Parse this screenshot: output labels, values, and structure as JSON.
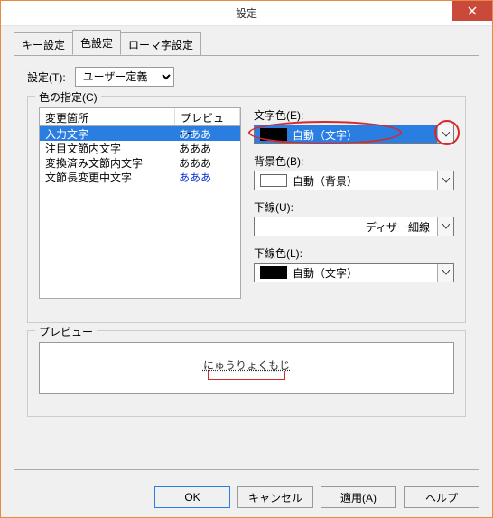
{
  "window": {
    "title": "設定"
  },
  "tabs": [
    {
      "label": "キー設定",
      "active": false
    },
    {
      "label": "色設定",
      "active": true
    },
    {
      "label": "ローマ字設定",
      "active": false
    }
  ],
  "setting": {
    "label": "設定(T):",
    "value": "ユーザー定義"
  },
  "colorgroup": {
    "legend": "色の指定(C)",
    "list": {
      "headers": {
        "col1": "変更箇所",
        "col2": "プレビュー"
      },
      "rows": [
        {
          "label": "入力文字",
          "preview": "あああ",
          "selected": true,
          "previewBlue": false
        },
        {
          "label": "注目文節内文字",
          "preview": "あああ",
          "selected": false,
          "previewBlue": false
        },
        {
          "label": "変換済み文節内文字",
          "preview": "あああ",
          "selected": false,
          "previewBlue": false
        },
        {
          "label": "文節長変更中文字",
          "preview": "あああ",
          "selected": false,
          "previewBlue": true
        }
      ]
    },
    "foreground": {
      "label": "文字色(E):",
      "text": "自動（文字）",
      "swatch": "#000000",
      "selected": true
    },
    "background": {
      "label": "背景色(B):",
      "text": "自動（背景）",
      "swatch": "#ffffff"
    },
    "underline": {
      "label": "下線(U):",
      "text": "ディザー細線"
    },
    "underlineColor": {
      "label": "下線色(L):",
      "text": "自動（文字）",
      "swatch": "#000000"
    }
  },
  "preview": {
    "legend": "プレビュー",
    "text": "にゅうりょくもじ"
  },
  "buttons": {
    "ok": "OK",
    "cancel": "キャンセル",
    "apply": "適用(A)",
    "help": "ヘルプ"
  }
}
